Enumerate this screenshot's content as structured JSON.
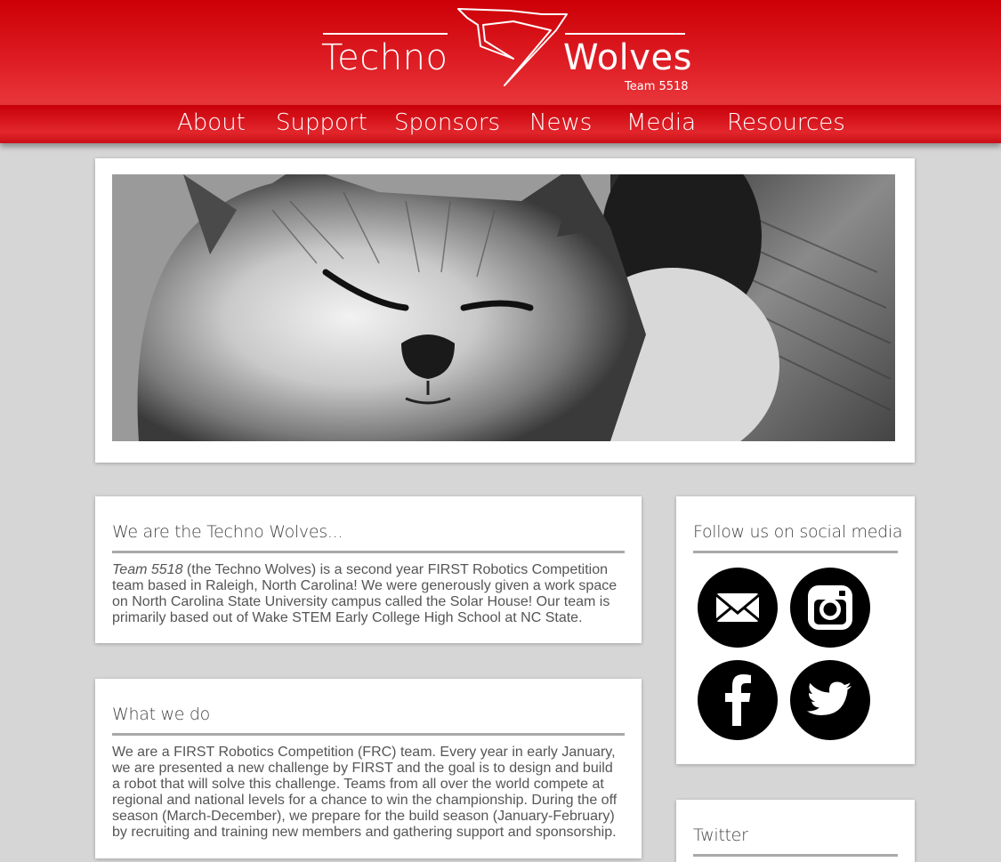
{
  "brand": {
    "name_left": "Techno",
    "name_right": "Wolves",
    "team": "Team 5518",
    "primary_color": "#d0000a"
  },
  "nav": {
    "items": [
      {
        "label": "About"
      },
      {
        "label": "Support"
      },
      {
        "label": "Sponsors"
      },
      {
        "label": "News"
      },
      {
        "label": "Media"
      },
      {
        "label": "Resources"
      }
    ]
  },
  "hero": {
    "image": "black-and-white-kitten-photo"
  },
  "about": {
    "title": "We are the Techno Wolves...",
    "team_italic": "Team 5518",
    "body": " (the Techno Wolves) is a second year FIRST Robotics Competition team based in Raleigh, North Carolina! We were generously given a work space on North Carolina State University campus called the Solar House! Our team is primarily based out of Wake STEM Early College High School at NC State."
  },
  "what_we_do": {
    "title": "What we do",
    "body": "We are a FIRST Robotics Competition (FRC) team. Every year in early January, we are presented a new challenge by FIRST and the goal is to design and build a robot that will solve this challenge. Teams from all over the world compete at regional and national levels for a chance to win the championship. During the off season (March-December), we prepare for the build season (January-February) by recruiting and training new members and gathering support and sponsorship."
  },
  "social": {
    "title": "Follow us on social media",
    "buttons": [
      {
        "icon": "email-icon"
      },
      {
        "icon": "instagram-icon"
      },
      {
        "icon": "facebook-icon"
      },
      {
        "icon": "twitter-icon"
      }
    ]
  },
  "twitter": {
    "title": "Twitter"
  }
}
